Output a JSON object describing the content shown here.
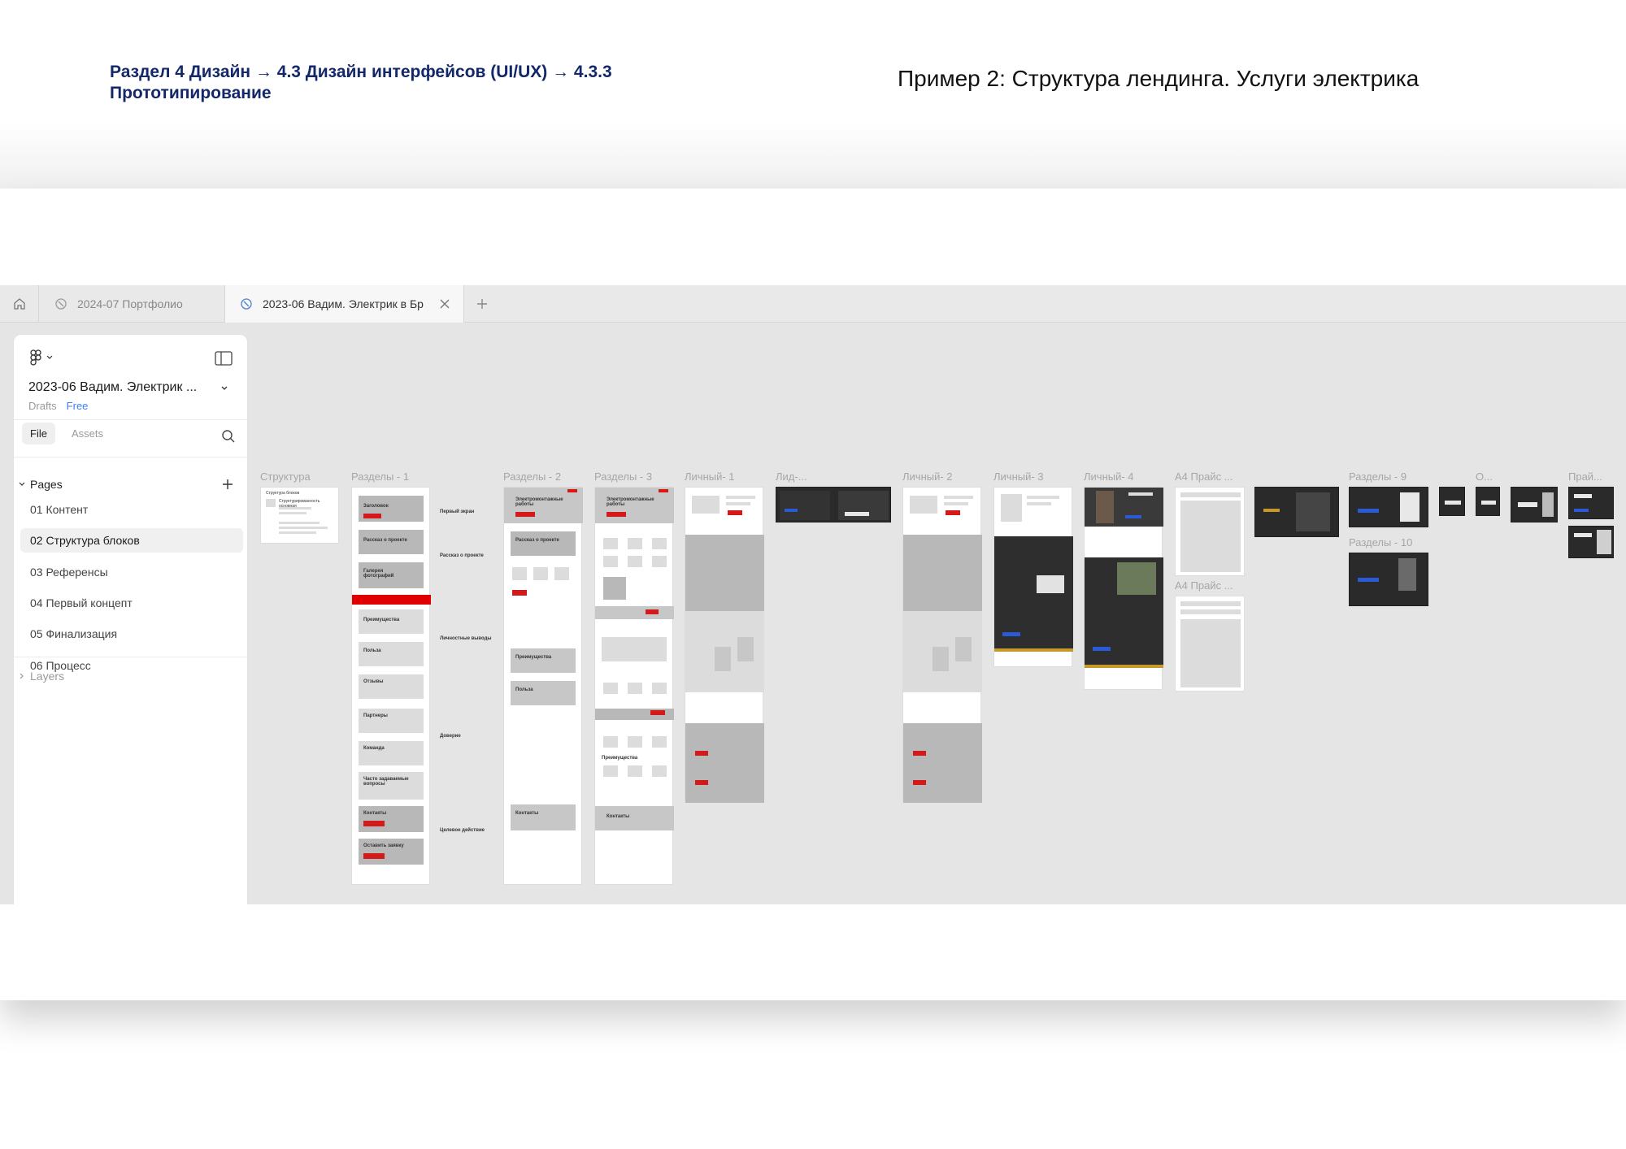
{
  "header": {
    "breadcrumb": "Раздел 4 Дизайн  → 4.3 Дизайн интерфейсов (UI/UX) → 4.3.3 Прототипирование",
    "title": "Пример 2: Структура лендинга. Услуги электрика"
  },
  "tabs": [
    {
      "label": "2024-07 Портфолио",
      "active": false
    },
    {
      "label": "2023-06 Вадим. Электрик в Бр",
      "active": true
    }
  ],
  "sidebar": {
    "file_name": "2023-06 Вадим. Электрик ...",
    "drafts": "Drafts",
    "plan": "Free",
    "tabs": [
      "File",
      "Assets"
    ],
    "pages_title": "Pages",
    "pages": [
      {
        "label": "01 Контент",
        "active": false
      },
      {
        "label": "02 Структура блоков",
        "active": true
      },
      {
        "label": "03 Референсы",
        "active": false
      },
      {
        "label": "04 Первый концепт",
        "active": false
      },
      {
        "label": "05 Финализация",
        "active": false
      },
      {
        "label": "06 Процесс",
        "active": false
      }
    ],
    "layers_title": "Layers"
  },
  "canvas": {
    "frame_labels": [
      "Структура",
      "Разделы - 1",
      "Разделы - 2",
      "Разделы - 3",
      "Личный- 1",
      "Лид-...",
      "Личный- 2",
      "Личный- 3",
      "Личный- 4",
      "A4 Прайс ...",
      "A4 Прайс ...",
      "Разделы - 9",
      "Разделы - 10",
      "О...",
      "Прай..."
    ],
    "structure_text": [
      "Структура блоков",
      "Структурированность основная"
    ],
    "sections1_blocks": [
      "Заголовок",
      "Рассказ о проекте",
      "Галерея фотографий",
      "Преимущества",
      "Польза",
      "Отзывы",
      "Партнеры",
      "Команда",
      "Часто задаваемые вопросы",
      "Контакты",
      "Оставить заявку"
    ],
    "sections1_notes": [
      "Первый экран",
      "Рассказ о проекте",
      "Личностные выводы",
      "Доверие",
      "Целевое действие"
    ],
    "sections2_blocks": [
      "Электромонтажные работы",
      "Рассказ о проекте",
      "Преимущества",
      "Польза",
      "Контакты"
    ],
    "sections3_blocks": [
      "Электромонтажные работы",
      "Преимущества",
      "Контакты"
    ]
  },
  "colors": {
    "brand_navy": "#13286a",
    "wire_red": "#d21a1a",
    "canvas_bg": "#e5e5e5",
    "accent_blue": "#3b82f6"
  }
}
